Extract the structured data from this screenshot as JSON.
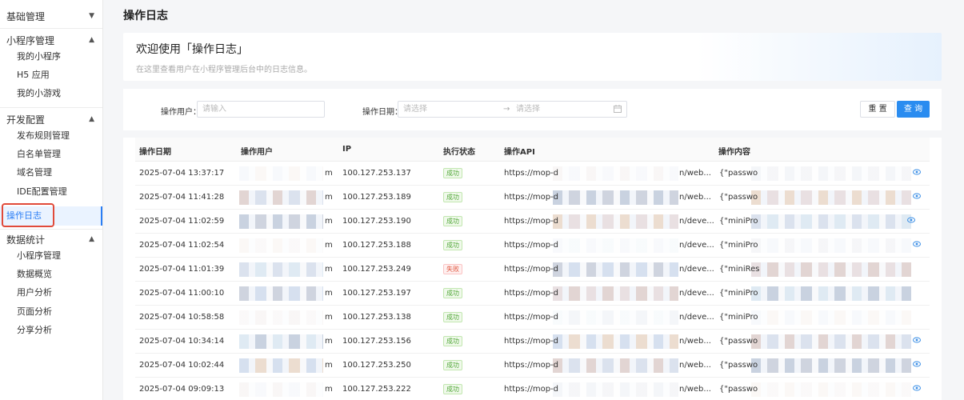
{
  "sidebar": {
    "groups": [
      {
        "label": "基础管理",
        "chevron": "chevron-down-icon",
        "items": []
      },
      {
        "label": "小程序管理",
        "chevron": "chevron-up-icon",
        "items": [
          "我的小程序",
          "H5 应用",
          "我的小游戏"
        ]
      },
      {
        "label": "开发配置",
        "chevron": "chevron-up-icon",
        "items": [
          "发布规则管理",
          "白名单管理",
          "域名管理",
          "IDE配置管理"
        ]
      },
      {
        "label": "数据统计",
        "chevron": "chevron-up-icon",
        "items": [
          "小程序管理",
          "数据概览",
          "用户分析",
          "页面分析",
          "分享分析"
        ]
      }
    ],
    "active_item": "操作日志"
  },
  "page_title": "操作日志",
  "welcome": {
    "title": "欢迎使用「操作日志」",
    "subtitle": "在这里查看用户在小程序管理后台中的日志信息。"
  },
  "filter": {
    "user_label": "操作用户：",
    "user_placeholder": "请输入",
    "date_label": "操作日期：",
    "date_start_placeholder": "请选择",
    "date_separator": "→",
    "date_end_placeholder": "请选择",
    "reset_label": "重 置",
    "query_label": "查 询"
  },
  "table": {
    "columns": [
      "操作日期",
      "操作用户",
      "IP",
      "执行状态",
      "操作API",
      "操作内容"
    ],
    "rows": [
      {
        "date": "2025-07-04 13:37:17",
        "user_suffix": "m",
        "ip": "100.127.253.137",
        "status": "成功",
        "api_prefix": "https://mop-d",
        "api_suffix": "n/web...",
        "content": "{\"passwo"
      },
      {
        "date": "2025-07-04 11:41:28",
        "user_suffix": "m",
        "ip": "100.127.253.189",
        "status": "成功",
        "api_prefix": "https://mop-d",
        "api_suffix": "n/web...",
        "content": "{\"passwo"
      },
      {
        "date": "2025-07-04 11:02:59",
        "user_suffix": "m",
        "ip": "100.127.253.190",
        "status": "成功",
        "api_prefix": "https://mop-d",
        "api_suffix": "n/deve...",
        "content": "{\"miniPro"
      },
      {
        "date": "2025-07-04 11:02:54",
        "user_suffix": "m",
        "ip": "100.127.253.188",
        "status": "成功",
        "api_prefix": "https://mop-d",
        "api_suffix": "n/deve...",
        "content": "{\"miniPro"
      },
      {
        "date": "2025-07-04 11:01:39",
        "user_suffix": "m",
        "ip": "100.127.253.249",
        "status": "失败",
        "api_prefix": "https://mop-d",
        "api_suffix": "n/deve...",
        "content": "{\"miniRes"
      },
      {
        "date": "2025-07-04 11:00:10",
        "user_suffix": "m",
        "ip": "100.127.253.197",
        "status": "成功",
        "api_prefix": "https://mop-d",
        "api_suffix": "n/deve...",
        "content": "{\"miniPro"
      },
      {
        "date": "2025-07-04 10:58:58",
        "user_suffix": "m",
        "ip": "100.127.253.138",
        "status": "成功",
        "api_prefix": "https://mop-d",
        "api_suffix": "n/deve...",
        "content": "{\"miniPro"
      },
      {
        "date": "2025-07-04 10:34:14",
        "user_suffix": "m",
        "ip": "100.127.253.156",
        "status": "成功",
        "api_prefix": "https://mop-d",
        "api_suffix": "n/web...",
        "content": "{\"passwo"
      },
      {
        "date": "2025-07-04 10:02:44",
        "user_suffix": "m",
        "ip": "100.127.253.250",
        "status": "成功",
        "api_prefix": "https://mop-d",
        "api_suffix": "n/web...",
        "content": "{\"passwo"
      },
      {
        "date": "2025-07-04 09:09:13",
        "user_suffix": "m",
        "ip": "100.127.253.222",
        "status": "成功",
        "api_prefix": "https://mop-d",
        "api_suffix": "n/web...",
        "content": "{\"passwo"
      }
    ]
  },
  "icons": {
    "calendar": "calendar-icon",
    "view": "eye-icon"
  },
  "colors": {
    "primary": "#2a8cf0",
    "success": "#52a83a",
    "fail": "#e0533a",
    "highlight": "#e14a3a"
  }
}
